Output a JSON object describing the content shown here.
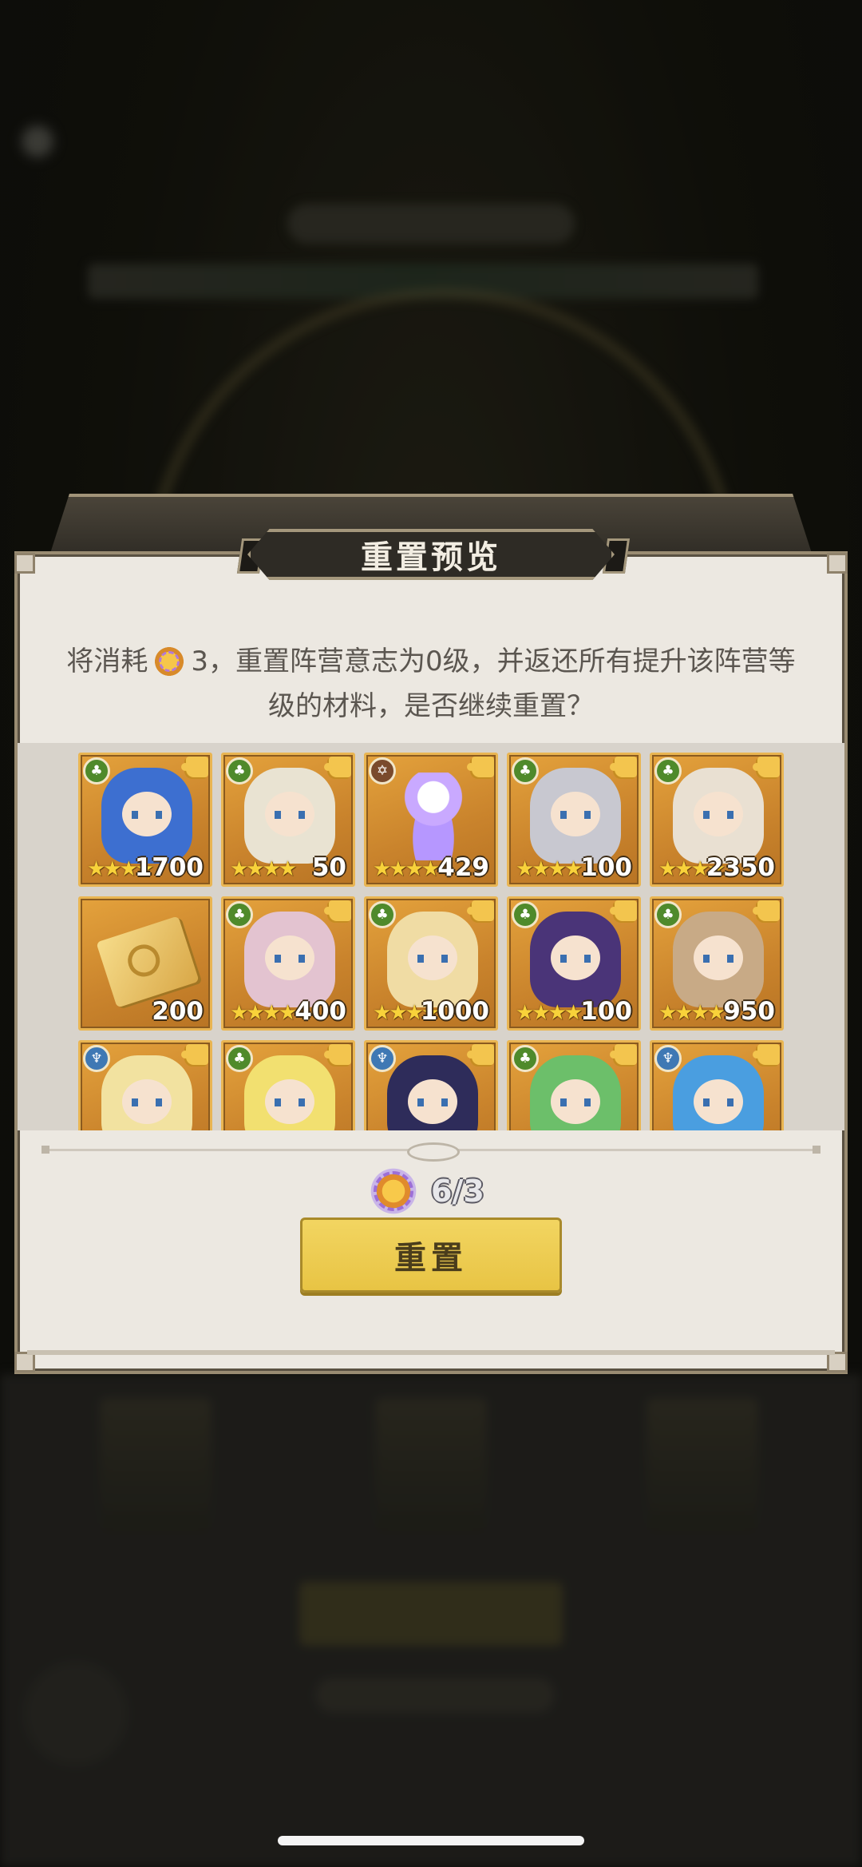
{
  "dialog": {
    "title": "重置预览",
    "message_part1": "将消耗",
    "message_count": "3",
    "message_part2": "，重置阵营意志为0级，并返还所有提升该阵营等级的材料，是否继续重置？",
    "cost_icon": "faction-will-token-icon",
    "cost_text": "6/3",
    "reset_label": "重置"
  },
  "items": [
    {
      "kind": "hero",
      "faction": "nature",
      "stars": 4,
      "qty": "1700",
      "tint": "#3d6fd0"
    },
    {
      "kind": "hero",
      "faction": "nature",
      "stars": 4,
      "qty": "50",
      "tint": "#e9e3d2"
    },
    {
      "kind": "soul",
      "faction": "star",
      "stars": 4,
      "qty": "429",
      "tint": "#c9a9ff"
    },
    {
      "kind": "hero",
      "faction": "nature",
      "stars": 4,
      "qty": "100",
      "tint": "#c8c8d0"
    },
    {
      "kind": "hero",
      "faction": "nature",
      "stars": 4,
      "qty": "2350",
      "tint": "#e9e0d2"
    },
    {
      "kind": "book",
      "faction": "",
      "stars": 0,
      "qty": "200",
      "tint": "#f0cf72"
    },
    {
      "kind": "hero",
      "faction": "nature",
      "stars": 4,
      "qty": "400",
      "tint": "#e3c3d0"
    },
    {
      "kind": "hero",
      "faction": "nature",
      "stars": 4,
      "qty": "1000",
      "tint": "#f0dca4"
    },
    {
      "kind": "hero",
      "faction": "nature",
      "stars": 4,
      "qty": "100",
      "tint": "#4a3478"
    },
    {
      "kind": "hero",
      "faction": "nature",
      "stars": 4,
      "qty": "950",
      "tint": "#c8aa86"
    },
    {
      "kind": "hero",
      "faction": "light",
      "stars": 4,
      "qty": "",
      "tint": "#f2e2a0"
    },
    {
      "kind": "hero",
      "faction": "nature",
      "stars": 4,
      "qty": "",
      "tint": "#f2e070"
    },
    {
      "kind": "hero",
      "faction": "light",
      "stars": 4,
      "qty": "",
      "tint": "#2e2c5a"
    },
    {
      "kind": "hero",
      "faction": "nature",
      "stars": 4,
      "qty": "",
      "tint": "#6cbf6a"
    },
    {
      "kind": "hero",
      "faction": "light",
      "stars": 4,
      "qty": "",
      "tint": "#4a9ee0"
    }
  ]
}
